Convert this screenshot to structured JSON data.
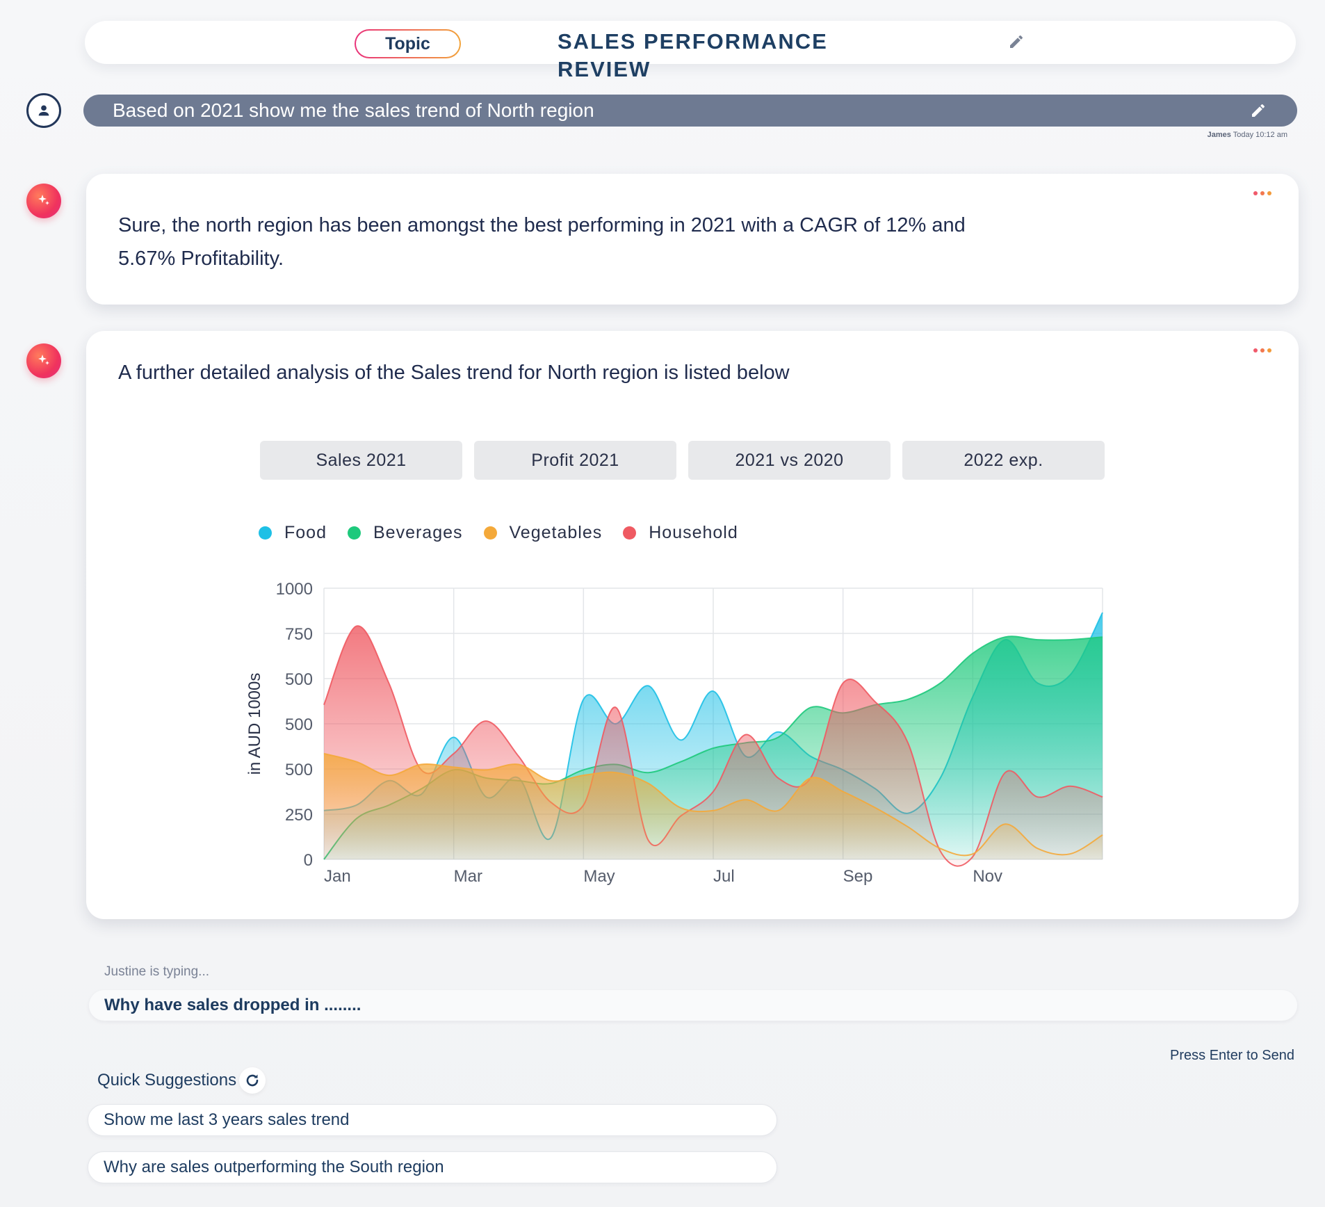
{
  "header": {
    "topic_label": "Topic",
    "title": "SALES PERFORMANCE REVIEW"
  },
  "query": {
    "text": "Based on 2021 show me the sales trend of North region",
    "author": "James",
    "time": "Today 10:12 am"
  },
  "response1": {
    "line1": "Sure, the north region has been amongst the best performing in 2021 with a CAGR of 12% and",
    "line2": "5.67% Profitability."
  },
  "response2": {
    "intro": "A further detailed analysis of the Sales trend for North region is listed below",
    "tabs": [
      "Sales 2021",
      "Profit 2021",
      "2021 vs 2020",
      "2022 exp."
    ]
  },
  "chart_data": {
    "type": "area",
    "ylabel": "in AUD 1000s",
    "y_tick_labels": [
      "1000",
      "750",
      "500",
      "500",
      "500",
      "250",
      "0"
    ],
    "ylim": [
      0,
      1000
    ],
    "x_tick_labels": [
      "Jan",
      "Mar",
      "May",
      "Jul",
      "Sep",
      "Nov"
    ],
    "x": [
      0,
      0.5,
      1,
      1.5,
      2,
      2.5,
      3,
      3.5,
      4,
      4.5,
      5,
      5.5,
      6,
      6.5,
      7,
      7.5,
      8,
      8.5,
      9,
      9.5,
      10,
      10.5,
      11,
      11.5,
      12
    ],
    "xlim": [
      0,
      12
    ],
    "grid": true,
    "legend_position": "top-left",
    "series": [
      {
        "name": "Food",
        "color": "#1ec0e6",
        "values": [
          180,
          200,
          290,
          240,
          450,
          230,
          300,
          80,
          590,
          500,
          640,
          440,
          620,
          380,
          470,
          380,
          330,
          260,
          170,
          300,
          600,
          810,
          650,
          680,
          910
        ]
      },
      {
        "name": "Beverages",
        "color": "#1ec97c",
        "values": [
          0,
          150,
          200,
          260,
          330,
          300,
          290,
          280,
          330,
          350,
          320,
          360,
          410,
          430,
          450,
          560,
          540,
          570,
          590,
          650,
          760,
          820,
          810,
          810,
          820
        ]
      },
      {
        "name": "Vegetables",
        "color": "#f4a93a",
        "values": [
          390,
          360,
          310,
          350,
          340,
          330,
          350,
          290,
          310,
          320,
          280,
          190,
          180,
          220,
          180,
          300,
          250,
          190,
          120,
          40,
          20,
          130,
          40,
          20,
          90
        ]
      },
      {
        "name": "Household",
        "color": "#ef5a62",
        "values": [
          570,
          860,
          650,
          330,
          390,
          510,
          380,
          210,
          200,
          560,
          70,
          160,
          250,
          460,
          300,
          300,
          650,
          580,
          430,
          30,
          10,
          320,
          230,
          270,
          230
        ]
      }
    ]
  },
  "typing": {
    "status": "Justine is typing...",
    "input_value": "Why have sales dropped in ........",
    "send_hint": "Press Enter to Send"
  },
  "suggestions": {
    "label": "Quick Suggestions",
    "items": [
      "Show me last 3 years sales trend",
      "Why are sales outperforming the South region"
    ]
  }
}
